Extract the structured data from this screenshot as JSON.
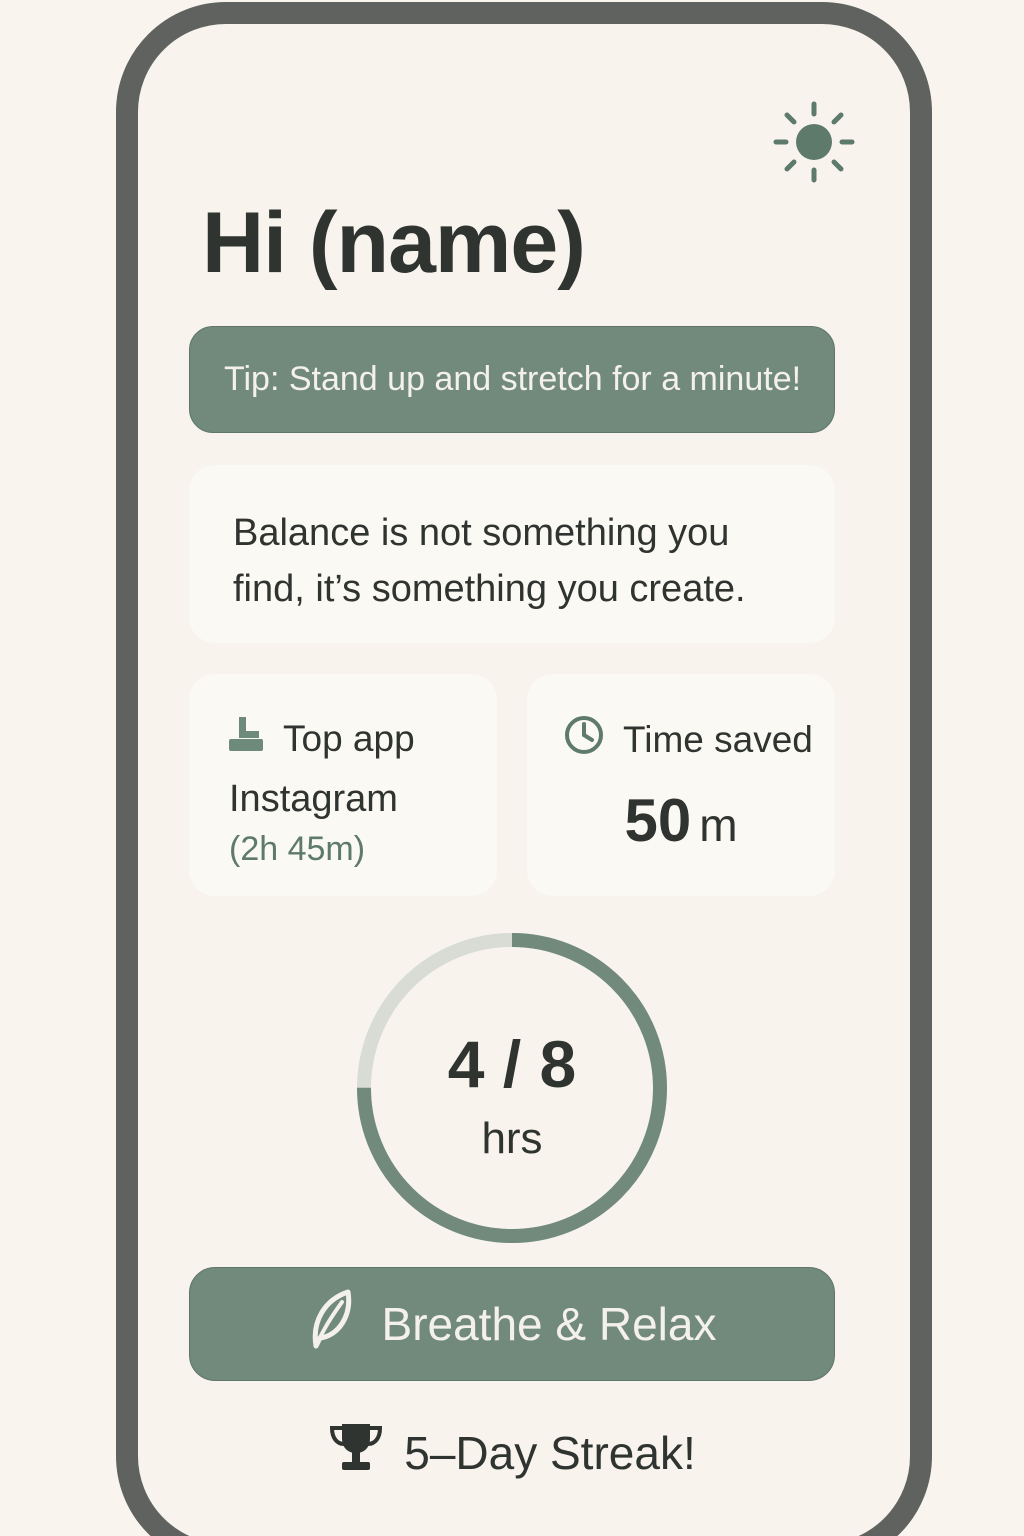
{
  "header": {
    "greeting": "Hi (name)",
    "theme_icon": "sun-icon"
  },
  "tip": {
    "text": "Tip: Stand up and stretch for a minute!"
  },
  "quote": {
    "text": "Balance is not something you find, it’s something you create."
  },
  "top_app": {
    "icon": "app-stack-icon",
    "label": "Top app",
    "name": "Instagram",
    "time": "(2h 45m)"
  },
  "time_saved": {
    "icon": "clock-icon",
    "label": "Time saved",
    "value": "50",
    "unit": "m"
  },
  "progress": {
    "value_text": "4 / 8",
    "unit": "hrs",
    "current": 4,
    "goal": 8
  },
  "breathe_button": {
    "icon": "leaf-icon",
    "label": "Breathe & Relax"
  },
  "streak": {
    "icon": "trophy-icon",
    "text": "5–Day Streak!"
  },
  "colors": {
    "accent": "#718a7c",
    "frame": "#5f625e",
    "text": "#2f3431",
    "ring_track": "#d9dcd4"
  }
}
